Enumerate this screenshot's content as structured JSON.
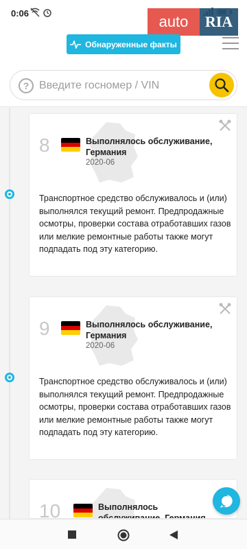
{
  "status_bar": {
    "time": "0:06",
    "icons": [
      "wifi-off-icon",
      "alarm-icon"
    ],
    "right_icons": [
      "signal-icon",
      "battery-icon"
    ]
  },
  "header": {
    "facts_button_label": "Обнаруженные факты",
    "logo_auto": "auto",
    "logo_ria": "RIA"
  },
  "search": {
    "placeholder": "Введите госномер / VIN"
  },
  "timeline": {
    "cards": [
      {
        "number": "8",
        "title": "Выполнялось обслуживание, Германия",
        "date": "2020-06",
        "description": "Транспортное средство обслуживалось и (или) выполнялся текущий ремонт. Предпродажные осмотры, проверки состава отработавших газов или мелкие ремонтные работы также могут подпадать под эту категорию."
      },
      {
        "number": "9",
        "title": "Выполнялось обслуживание, Германия",
        "date": "2020-06",
        "description": "Транспортное средство обслуживалось и (или) выполнялся текущий ремонт. Предпродажные осмотры, проверки состава отработавших газов или мелкие ремонтные работы также могут подпадать под эту категорию."
      },
      {
        "number": "10",
        "title": "Выполнялось обслуживание, Германия",
        "date": "",
        "description": ""
      }
    ]
  },
  "colors": {
    "accent": "#1fb6e0",
    "search_button": "#f6c300",
    "flag_black": "#000000",
    "flag_red": "#dd0000",
    "flag_gold": "#ffce00"
  }
}
